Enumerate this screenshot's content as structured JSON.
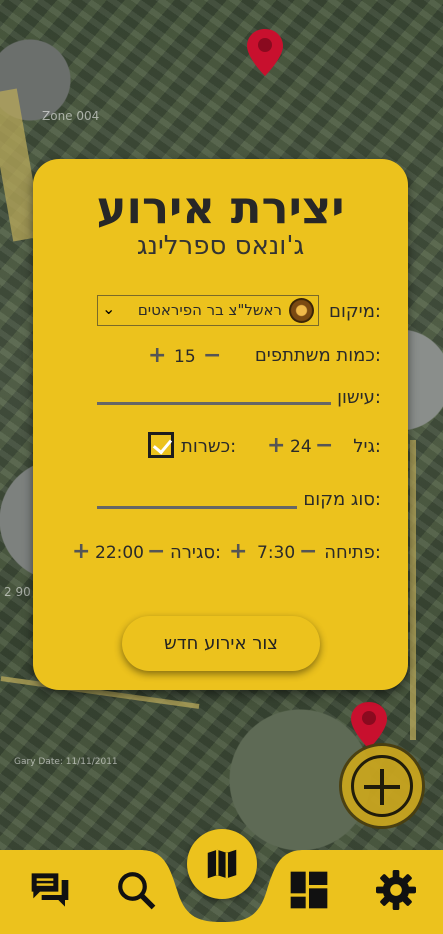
{
  "map": {
    "labels": [
      "Zone 004",
      "2 90"
    ],
    "bottom_label": "Gary Date: 11/11/2011"
  },
  "dialog": {
    "title": "יצירת אירוע",
    "subtitle": "ג'ונאס ספרלינג",
    "location": {
      "label": "מיקום:",
      "selected": "ראשל\"צ בר הפיראטים"
    },
    "participants": {
      "label": "כמות משתתפים:",
      "value": "15"
    },
    "smoking": {
      "label": "עישון:",
      "value": ""
    },
    "age": {
      "label": "גיל:",
      "value": "24"
    },
    "kosher": {
      "label": "כשרות:",
      "checked": true
    },
    "place_type": {
      "label": "סוג מקום:",
      "value": ""
    },
    "opening": {
      "label": "פתיחה:",
      "value": "7:30"
    },
    "closing": {
      "label": "סגירה:",
      "value": "22:00"
    },
    "create_button": "צור אירוע חדש"
  },
  "colors": {
    "accent": "#ecc21d",
    "pin": "#c8102e",
    "bar": "#ecc21d"
  },
  "nav": {
    "items": [
      "chat-icon",
      "search-icon",
      "map-icon",
      "dashboard-icon",
      "gear-icon"
    ],
    "active": "map-icon"
  }
}
